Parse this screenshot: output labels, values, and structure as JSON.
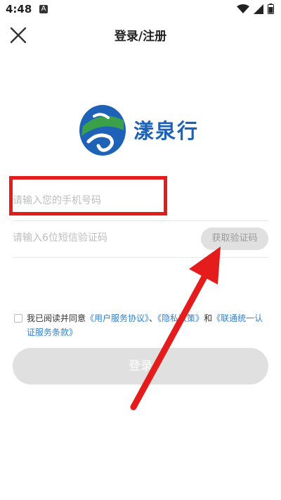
{
  "status_bar": {
    "time": "4:48",
    "app_icon": "A"
  },
  "header": {
    "title": "登录/注册",
    "close_icon": "close-icon"
  },
  "logo": {
    "text": "漾泉行"
  },
  "form": {
    "phone_placeholder": "请输入您的手机号码",
    "code_placeholder": "请输入6位短信验证码",
    "get_code_label": "获取验证码"
  },
  "agreement": {
    "prefix": "我已阅读并同意",
    "user_agreement": "《用户服务协议》",
    "sep1": "、",
    "privacy_policy": "《隐私政策》",
    "and": "和",
    "unicom_terms": "《联通统一认证服务条款》"
  },
  "login": {
    "label": "登录"
  },
  "colors": {
    "brand_blue": "#1e62b8",
    "brand_green": "#3aa14a",
    "annotation_red": "#e51c1c",
    "link": "#2f7fd1"
  }
}
